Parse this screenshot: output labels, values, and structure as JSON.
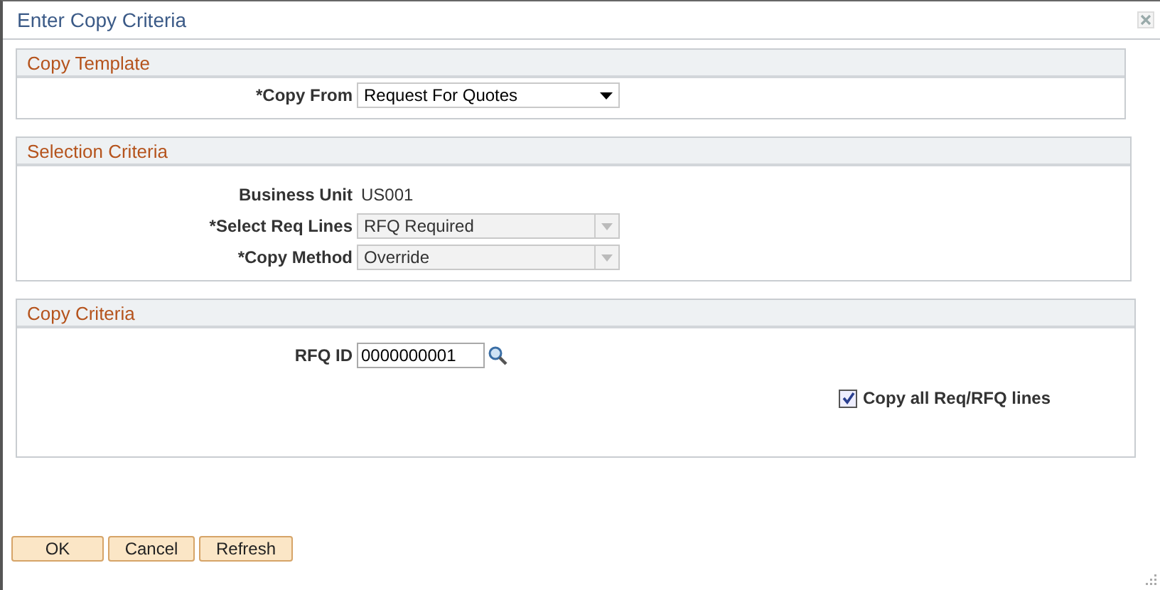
{
  "window": {
    "title": "Enter Copy Criteria"
  },
  "sections": [
    {
      "title": "Copy Template",
      "fields": [
        {
          "kind": "dropdown",
          "label": "*Copy From",
          "value": "Request For Quotes",
          "disabled": false
        }
      ]
    },
    {
      "title": "Selection Criteria",
      "fields": [
        {
          "kind": "display",
          "label": "Business Unit",
          "value": "US001"
        },
        {
          "kind": "dropdown",
          "label": "*Select Req Lines",
          "value": "RFQ Required",
          "disabled": true
        },
        {
          "kind": "dropdown",
          "label": "*Copy Method",
          "value": "Override",
          "disabled": true
        }
      ]
    },
    {
      "title": "Copy Criteria",
      "fields": [
        {
          "kind": "lookup",
          "label": "RFQ ID",
          "value": "0000000001"
        },
        {
          "kind": "checkbox",
          "label": "Copy all Req/RFQ lines",
          "checked": true
        }
      ]
    }
  ],
  "buttons": [
    "OK",
    "Cancel",
    "Refresh"
  ]
}
